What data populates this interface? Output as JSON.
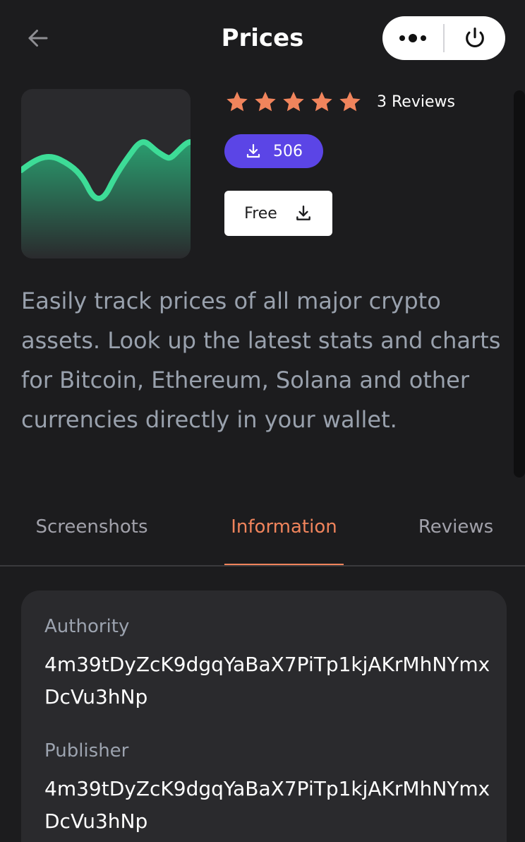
{
  "header": {
    "title": "Prices",
    "back_icon": "arrow-left-icon",
    "menu_icon": "more-dots-icon",
    "power_icon": "power-icon"
  },
  "app": {
    "rating": {
      "stars": 5,
      "max_stars": 5,
      "reviews_label": "3 Reviews",
      "star_color": "#f0845c"
    },
    "downloads": {
      "count": "506",
      "icon": "download-icon",
      "color": "#5b45e6"
    },
    "price_button": {
      "label": "Free",
      "icon": "download-icon"
    },
    "description": "Easily track prices of all major crypto assets. Look up the latest stats and charts for Bitcoin, Ethereum, Solana and other currencies directly in your wallet."
  },
  "tabs": [
    {
      "label": "Screenshots",
      "active": false
    },
    {
      "label": "Information",
      "active": true
    },
    {
      "label": "Reviews",
      "active": false
    }
  ],
  "info": {
    "authority_label": "Authority",
    "authority_value": "4m39tDyZcK9dgqYaBaX7PiTp1kjAKrMhNYmxDcVu3hNp",
    "publisher_label": "Publisher",
    "publisher_value": "4m39tDyZcK9dgqYaBaX7PiTp1kjAKrMhNYmxDcVu3hNp"
  },
  "colors": {
    "background": "#1c1c1e",
    "accent": "#f0845c",
    "chart_green": "#3ddc97"
  }
}
